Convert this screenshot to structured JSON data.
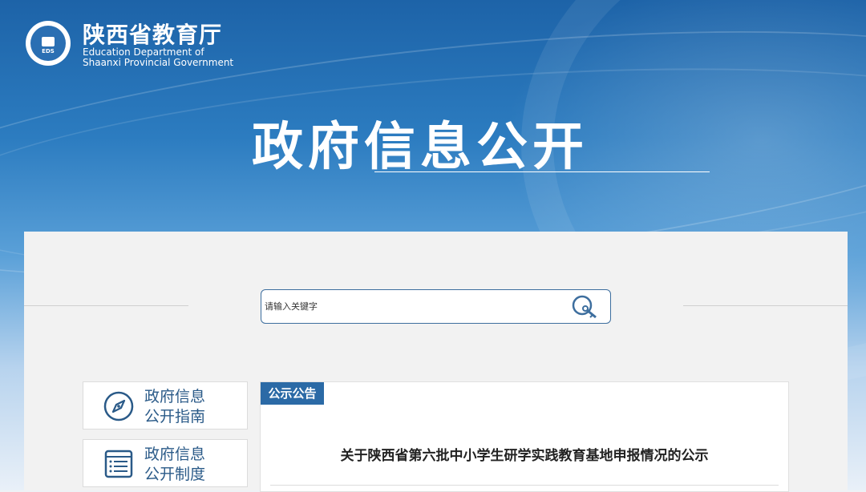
{
  "header": {
    "org_name_cn": "陕西省教育厅",
    "org_name_en_line1": "Education Department of",
    "org_name_en_line2": "Shaanxi Provincial Government",
    "logo_text": "EDS"
  },
  "hero": {
    "title": "政府信息公开"
  },
  "search": {
    "placeholder": "请输入关键字",
    "icon": "search-key-icon"
  },
  "sidebar": {
    "items": [
      {
        "line1": "政府信息",
        "line2": "公开指南",
        "icon": "compass-icon"
      },
      {
        "line1": "政府信息",
        "line2": "公开制度",
        "icon": "list-document-icon"
      }
    ]
  },
  "notice": {
    "tag": "公示公告",
    "title": "关于陕西省第六批中小学生研学实践教育基地申报情况的公示"
  },
  "colors": {
    "banner_blue": "#1d63a8",
    "accent_blue": "#2b6aa6",
    "nav_text": "#2a5a88",
    "panel_bg": "#f2f2f2"
  }
}
